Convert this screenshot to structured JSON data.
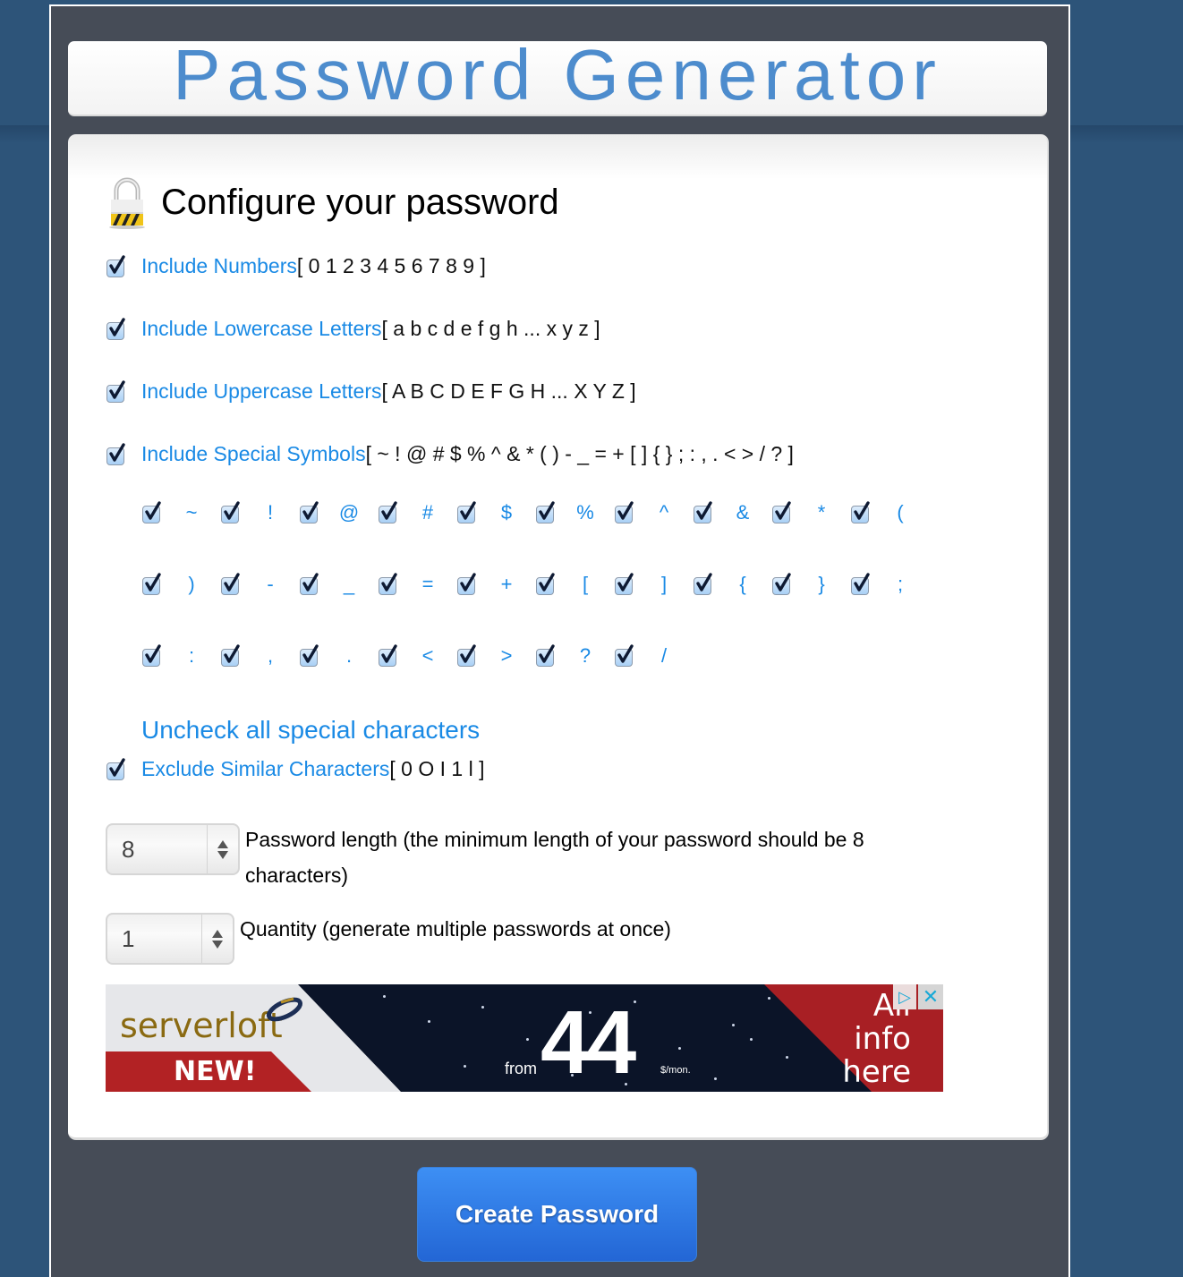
{
  "header": {
    "title": "Password Generator"
  },
  "section": {
    "title": "Configure your password",
    "icon": "padlock-icon"
  },
  "options": [
    {
      "label": "Include Numbers",
      "chars": "[ 0 1 2 3 4 5 6 7 8 9 ]",
      "checked": true
    },
    {
      "label": "Include Lowercase Letters",
      "chars": "[ a b c d e f g h ... x y z ]",
      "checked": true
    },
    {
      "label": "Include Uppercase Letters",
      "chars": "[ A B C D E F G H ... X Y Z ]",
      "checked": true
    },
    {
      "label": "Include Special Symbols",
      "chars": "[ ~ ! @ # $ % ^ & * ( ) - _ = + [ ] { } ; : , . < > / ? ]",
      "checked": true
    }
  ],
  "symbols": {
    "rows": [
      [
        "~",
        "!",
        "@",
        "#",
        "$",
        "%",
        "^",
        "&",
        "*",
        "("
      ],
      [
        ")",
        "-",
        "_",
        "=",
        "+",
        "[",
        "]",
        "{",
        "}",
        ";"
      ],
      [
        ":",
        ",",
        ".",
        "<",
        ">",
        "?",
        "/"
      ]
    ],
    "all_checked": true
  },
  "uncheck_all_label": "Uncheck all special characters",
  "exclude_similar": {
    "label": "Exclude Similar Characters",
    "chars": "[ 0 O I 1 l ]",
    "checked": true
  },
  "password_length": {
    "value": "8",
    "text": "Password length (the minimum length of your password should be 8 characters)"
  },
  "quantity": {
    "value": "1",
    "text": "Quantity (generate multiple passwords at once)"
  },
  "ad": {
    "brand": "serverloft",
    "badge": "NEW!",
    "from": "from",
    "price": "44",
    "unit": "$/mon.",
    "cta_lines": [
      "All",
      "info",
      "here"
    ],
    "adchoices_icon": "adchoices-icon",
    "close_icon": "close-icon"
  },
  "create_button": {
    "label": "Create Password"
  },
  "colors": {
    "accent": "#1a8ae5",
    "title": "#4d8ccd",
    "button": "#2f7be6",
    "page_bg": "#2d5479",
    "column_bg": "#464c57"
  }
}
